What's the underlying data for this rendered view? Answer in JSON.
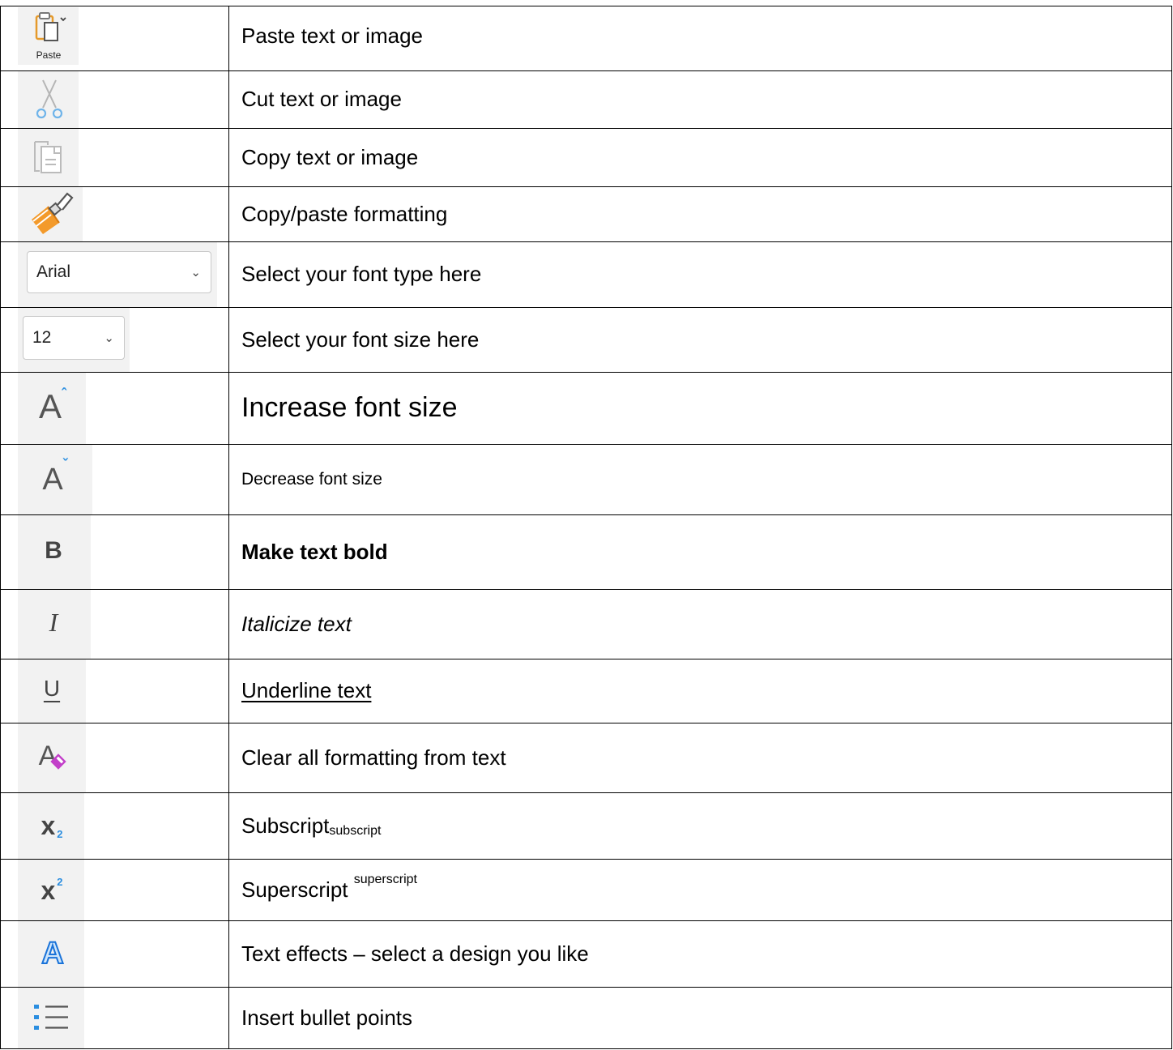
{
  "rows": [
    {
      "icon": "paste-icon",
      "icon_label": "Paste",
      "text": "Paste text or image"
    },
    {
      "icon": "cut-icon",
      "text": "Cut text or image"
    },
    {
      "icon": "copy-icon",
      "text": "Copy text or image"
    },
    {
      "icon": "format-painter-icon",
      "text": "Copy/paste formatting"
    },
    {
      "icon": "font-name-dropdown",
      "value": "Arial",
      "text": "Select your font type here"
    },
    {
      "icon": "font-size-dropdown",
      "value": "12",
      "text": "Select your font size here"
    },
    {
      "icon": "increase-font-size-icon",
      "glyph": "A",
      "text": "Increase font size"
    },
    {
      "icon": "decrease-font-size-icon",
      "glyph": "A",
      "text": "Decrease font size"
    },
    {
      "icon": "bold-icon",
      "glyph": "B",
      "text": "Make text bold"
    },
    {
      "icon": "italic-icon",
      "glyph": "I",
      "text": "Italicize text"
    },
    {
      "icon": "underline-icon",
      "glyph": "U",
      "text": "Underline text"
    },
    {
      "icon": "clear-formatting-icon",
      "glyph": "A",
      "text": "Clear all formatting from text"
    },
    {
      "icon": "subscript-icon",
      "glyph": "x",
      "glyph_sub": "2",
      "text": "Subscript",
      "text_sub": "subscript"
    },
    {
      "icon": "superscript-icon",
      "glyph": "x",
      "glyph_sup": "2",
      "text": "Superscript ",
      "text_sup": "superscript"
    },
    {
      "icon": "text-effects-icon",
      "glyph": "A",
      "text": "Text effects – select a design you like"
    },
    {
      "icon": "bullets-icon",
      "text": "Insert bullet points"
    }
  ],
  "colors": {
    "accent_blue": "#2b8ee0",
    "paint_orange": "#f39a2b",
    "eraser_magenta": "#c23fc9"
  }
}
